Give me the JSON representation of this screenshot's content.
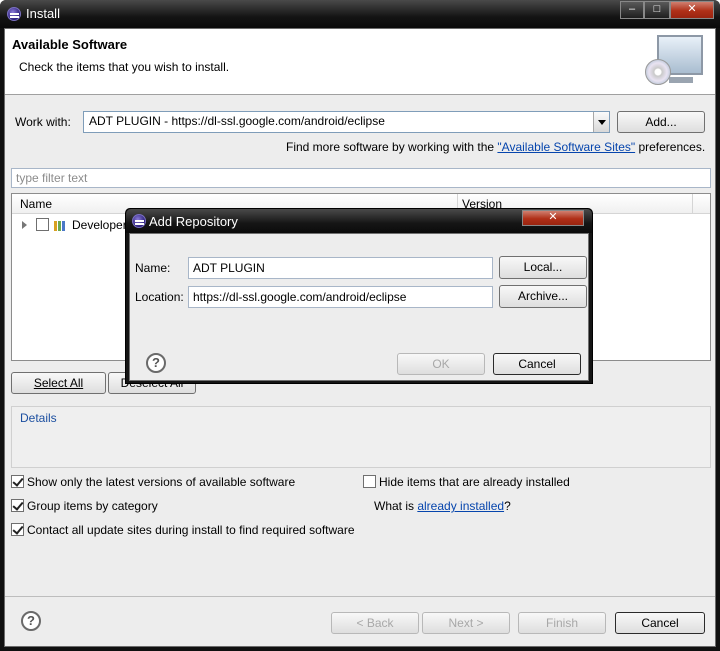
{
  "window": {
    "title": "Install",
    "controls": {
      "minimize": "–",
      "maximize": "□",
      "close": "✕"
    },
    "icon": "eclipse-icon"
  },
  "banner": {
    "title": "Available Software",
    "subtitle": "Check the items that you wish to install."
  },
  "work_with": {
    "label": "Work with:",
    "value": "ADT PLUGIN - https://dl-ssl.google.com/android/eclipse",
    "add_button": "Add...",
    "find_more_prefix": "Find more software by working with the ",
    "find_more_link": "\"Available Software Sites\"",
    "find_more_suffix": " preferences."
  },
  "filter": {
    "placeholder": "type filter text"
  },
  "table": {
    "columns": [
      "Name",
      "Version"
    ],
    "rows": [
      {
        "name": "Developer",
        "checked": false
      }
    ]
  },
  "selection_buttons": {
    "select_all": "Select All",
    "deselect_all": "Deselect All"
  },
  "details": {
    "label": "Details"
  },
  "options": {
    "show_latest": {
      "label": "Show only the latest versions of available software",
      "checked": true
    },
    "hide_installed": {
      "label": "Hide items that are already installed",
      "checked": false
    },
    "group_by_category": {
      "label": "Group items by category",
      "checked": true
    },
    "what_is_prefix": "What is ",
    "what_is_link": "already installed",
    "what_is_suffix": "?",
    "contact_sites": {
      "label": "Contact all update sites during install to find required software",
      "checked": true
    }
  },
  "footer": {
    "back": "< Back",
    "next": "Next >",
    "finish": "Finish",
    "cancel": "Cancel"
  },
  "dialog": {
    "title": "Add Repository",
    "name_label": "Name:",
    "name_value": "ADT PLUGIN",
    "local_button": "Local...",
    "location_label": "Location:",
    "location_value": "https://dl-ssl.google.com/android/eclipse",
    "archive_button": "Archive...",
    "ok_button": "OK",
    "cancel_button": "Cancel"
  },
  "colors": {
    "link": "#0645ad",
    "details_title": "#1c4fa0",
    "titlebar": "#141414"
  }
}
